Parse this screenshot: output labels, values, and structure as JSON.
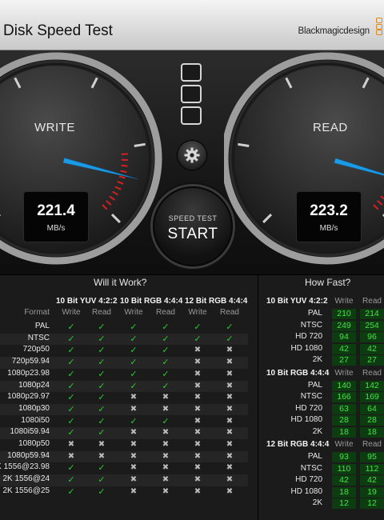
{
  "app": {
    "title": "Disk Speed Test",
    "brand": "Blackmagicdesign",
    "accent_color": "#e08a1a"
  },
  "gauges": {
    "write": {
      "label": "WRITE",
      "value": "221.4",
      "unit": "MB/s",
      "needle_mbps": 221.4
    },
    "read": {
      "label": "READ",
      "value": "223.2",
      "unit": "MB/s",
      "needle_mbps": 223.2
    }
  },
  "controls": {
    "mode_buttons": [
      "mode-1-icon",
      "mode-2-icon",
      "mode-3-icon"
    ],
    "settings_icon": "gear-icon",
    "start_small": "SPEED TEST",
    "start_big": "START"
  },
  "will_it_work": {
    "title": "Will it Work?",
    "format_header": "Format",
    "groups": [
      "10 Bit YUV 4:2:2",
      "10 Bit RGB 4:4:4",
      "12 Bit RGB 4:4:4"
    ],
    "subcols": [
      "Write",
      "Read"
    ],
    "rows": [
      {
        "format": "PAL",
        "cells": [
          "y",
          "y",
          "y",
          "y",
          "y",
          "y"
        ]
      },
      {
        "format": "NTSC",
        "cells": [
          "y",
          "y",
          "y",
          "y",
          "y",
          "y"
        ]
      },
      {
        "format": "720p50",
        "cells": [
          "y",
          "y",
          "y",
          "y",
          "n",
          "n"
        ]
      },
      {
        "format": "720p59.94",
        "cells": [
          "y",
          "y",
          "y",
          "y",
          "n",
          "n"
        ]
      },
      {
        "format": "1080p23.98",
        "cells": [
          "y",
          "y",
          "y",
          "y",
          "n",
          "n"
        ]
      },
      {
        "format": "1080p24",
        "cells": [
          "y",
          "y",
          "y",
          "y",
          "n",
          "n"
        ]
      },
      {
        "format": "1080p29.97",
        "cells": [
          "y",
          "y",
          "n",
          "n",
          "n",
          "n"
        ]
      },
      {
        "format": "1080p30",
        "cells": [
          "y",
          "y",
          "n",
          "n",
          "n",
          "n"
        ]
      },
      {
        "format": "1080i50",
        "cells": [
          "y",
          "y",
          "y",
          "y",
          "n",
          "n"
        ]
      },
      {
        "format": "1080i59.94",
        "cells": [
          "y",
          "y",
          "n",
          "n",
          "n",
          "n"
        ]
      },
      {
        "format": "1080p50",
        "cells": [
          "n",
          "n",
          "n",
          "n",
          "n",
          "n"
        ]
      },
      {
        "format": "1080p59.94",
        "cells": [
          "n",
          "n",
          "n",
          "n",
          "n",
          "n"
        ]
      },
      {
        "format": "2K 1556@23.98",
        "cells": [
          "y",
          "y",
          "n",
          "n",
          "n",
          "n"
        ]
      },
      {
        "format": "2K 1556@24",
        "cells": [
          "y",
          "y",
          "n",
          "n",
          "n",
          "n"
        ]
      },
      {
        "format": "2K 1556@25",
        "cells": [
          "y",
          "y",
          "n",
          "n",
          "n",
          "n"
        ]
      }
    ]
  },
  "how_fast": {
    "title": "How Fast?",
    "subcols": [
      "Write",
      "Read"
    ],
    "groups": [
      {
        "name": "10 Bit YUV 4:2:2",
        "rows": [
          {
            "format": "PAL",
            "write": "210",
            "read": "214"
          },
          {
            "format": "NTSC",
            "write": "249",
            "read": "254"
          },
          {
            "format": "HD 720",
            "write": "94",
            "read": "96"
          },
          {
            "format": "HD 1080",
            "write": "42",
            "read": "42"
          },
          {
            "format": "2K",
            "write": "27",
            "read": "27"
          }
        ]
      },
      {
        "name": "10 Bit RGB 4:4:4",
        "rows": [
          {
            "format": "PAL",
            "write": "140",
            "read": "142"
          },
          {
            "format": "NTSC",
            "write": "166",
            "read": "169"
          },
          {
            "format": "HD 720",
            "write": "63",
            "read": "64"
          },
          {
            "format": "HD 1080",
            "write": "28",
            "read": "28"
          },
          {
            "format": "2K",
            "write": "18",
            "read": "18"
          }
        ]
      },
      {
        "name": "12 Bit RGB 4:4:4",
        "rows": [
          {
            "format": "PAL",
            "write": "93",
            "read": "95"
          },
          {
            "format": "NTSC",
            "write": "110",
            "read": "112"
          },
          {
            "format": "HD 720",
            "write": "42",
            "read": "42"
          },
          {
            "format": "HD 1080",
            "write": "18",
            "read": "19"
          },
          {
            "format": "2K",
            "write": "12",
            "read": "12"
          }
        ]
      }
    ]
  }
}
